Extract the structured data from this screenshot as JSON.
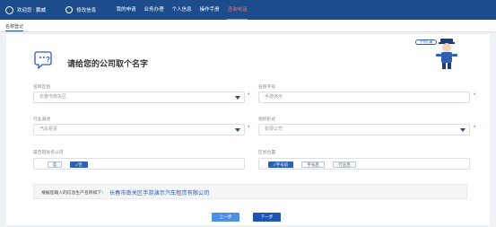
{
  "topnav": {
    "user": "欢迎您 : 鹏威",
    "edit": "修改信息",
    "links": [
      "我的申请",
      "业务办理",
      "个人信息",
      "操作手册",
      "咨询电话"
    ]
  },
  "breadcrumb": "名称登记",
  "card": {
    "title": "请给您的公司取个名字",
    "mascot_label": "干货小编"
  },
  "form": {
    "region": {
      "label": "名称区划",
      "value": "长春市南关区"
    },
    "trade_name": {
      "label": "名称字号",
      "value": "手游演示"
    },
    "industry": {
      "label": "行业表述",
      "value": "汽车租赁"
    },
    "org_form": {
      "label": "组织形式",
      "value": "有限公司"
    },
    "province": {
      "label": "是否冠省名公司",
      "options": [
        "是",
        "✓否"
      ]
    },
    "position": {
      "label": "区划位置",
      "options": [
        "✓字号前",
        "字号后",
        "行业后"
      ]
    }
  },
  "notice": {
    "label": "根据您输入的信息生产名称如下：",
    "name": "长春市南关区手游演示汽车租赁有限公司"
  },
  "buttons": {
    "prev": "上一步",
    "next": "下一步"
  },
  "colors": {
    "nav": "#1c4c8c",
    "primary": "#2e5fb0",
    "active": "#ff6b6b",
    "required": "#e02020"
  }
}
